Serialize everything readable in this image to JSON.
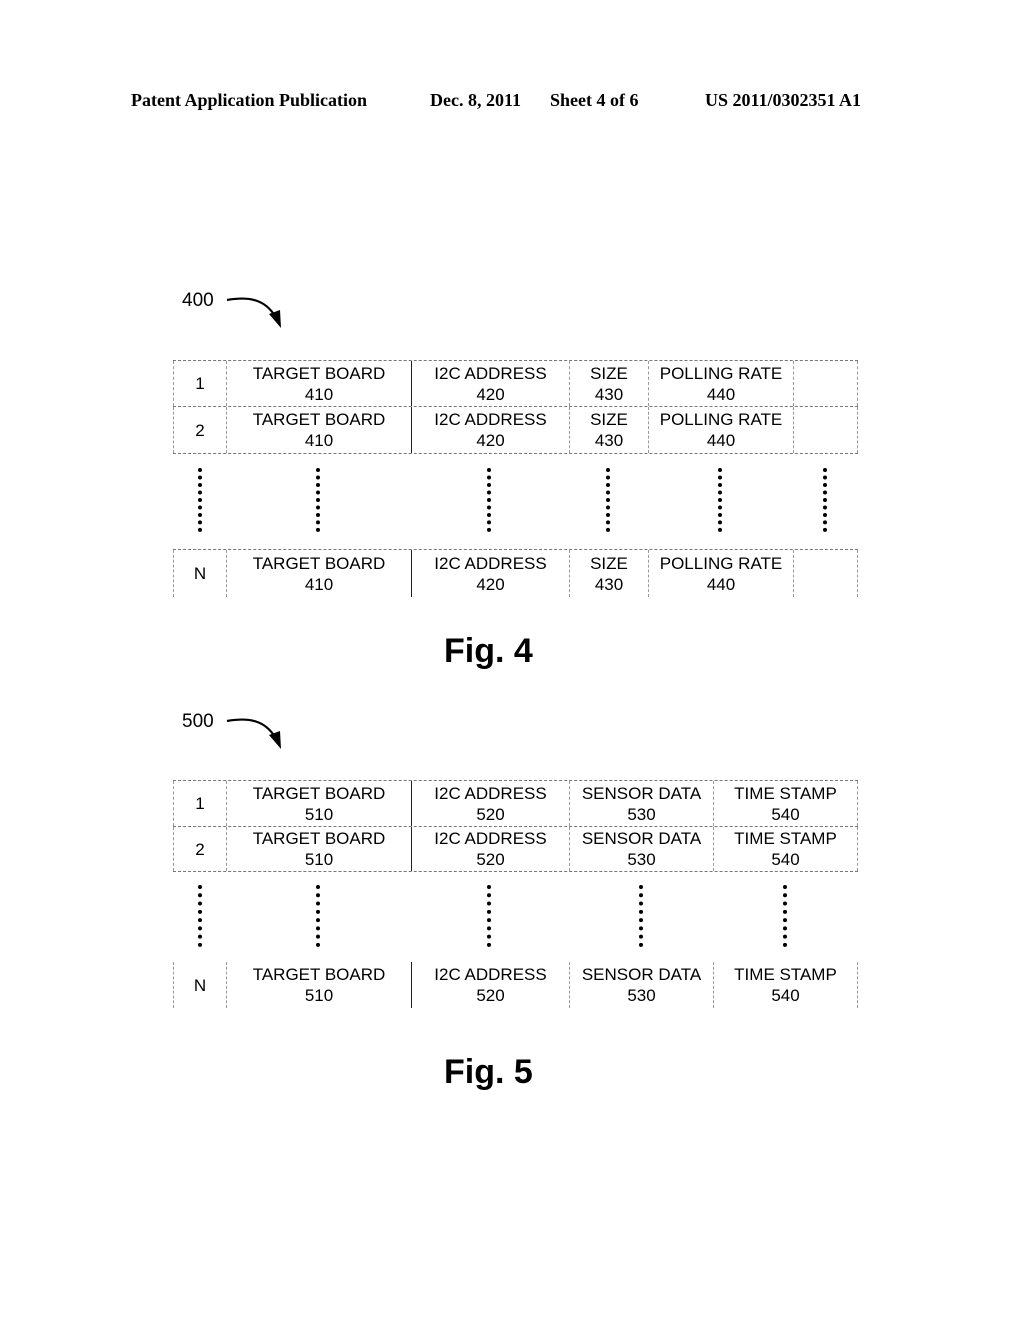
{
  "header": {
    "publication": "Patent Application Publication",
    "date": "Dec. 8, 2011",
    "sheet": "Sheet 4 of 6",
    "number": "US 2011/0302351 A1"
  },
  "fig4": {
    "ref": "400",
    "caption": "Fig. 4",
    "rows": [
      {
        "index": "1",
        "cells": [
          [
            "TARGET BOARD",
            "410"
          ],
          [
            "I2C ADDRESS",
            "420"
          ],
          [
            "SIZE",
            "430"
          ],
          [
            "POLLING RATE",
            "440"
          ],
          [
            "",
            ""
          ]
        ]
      },
      {
        "index": "2",
        "cells": [
          [
            "TARGET BOARD",
            "410"
          ],
          [
            "I2C ADDRESS",
            "420"
          ],
          [
            "SIZE",
            "430"
          ],
          [
            "POLLING RATE",
            "440"
          ],
          [
            "",
            ""
          ]
        ]
      },
      {
        "index": "N",
        "cells": [
          [
            "TARGET BOARD",
            "410"
          ],
          [
            "I2C ADDRESS",
            "420"
          ],
          [
            "SIZE",
            "430"
          ],
          [
            "POLLING RATE",
            "440"
          ],
          [
            "",
            ""
          ]
        ]
      }
    ]
  },
  "fig5": {
    "ref": "500",
    "caption": "Fig. 5",
    "rows": [
      {
        "index": "1",
        "cells": [
          [
            "TARGET BOARD",
            "510"
          ],
          [
            "I2C ADDRESS",
            "520"
          ],
          [
            "SENSOR DATA",
            "530"
          ],
          [
            "TIME STAMP",
            "540"
          ]
        ]
      },
      {
        "index": "2",
        "cells": [
          [
            "TARGET BOARD",
            "510"
          ],
          [
            "I2C ADDRESS",
            "520"
          ],
          [
            "SENSOR DATA",
            "530"
          ],
          [
            "TIME STAMP",
            "540"
          ]
        ]
      },
      {
        "index": "N",
        "cells": [
          [
            "TARGET BOARD",
            "510"
          ],
          [
            "I2C ADDRESS",
            "520"
          ],
          [
            "SENSOR DATA",
            "530"
          ],
          [
            "TIME STAMP",
            "540"
          ]
        ]
      }
    ]
  }
}
